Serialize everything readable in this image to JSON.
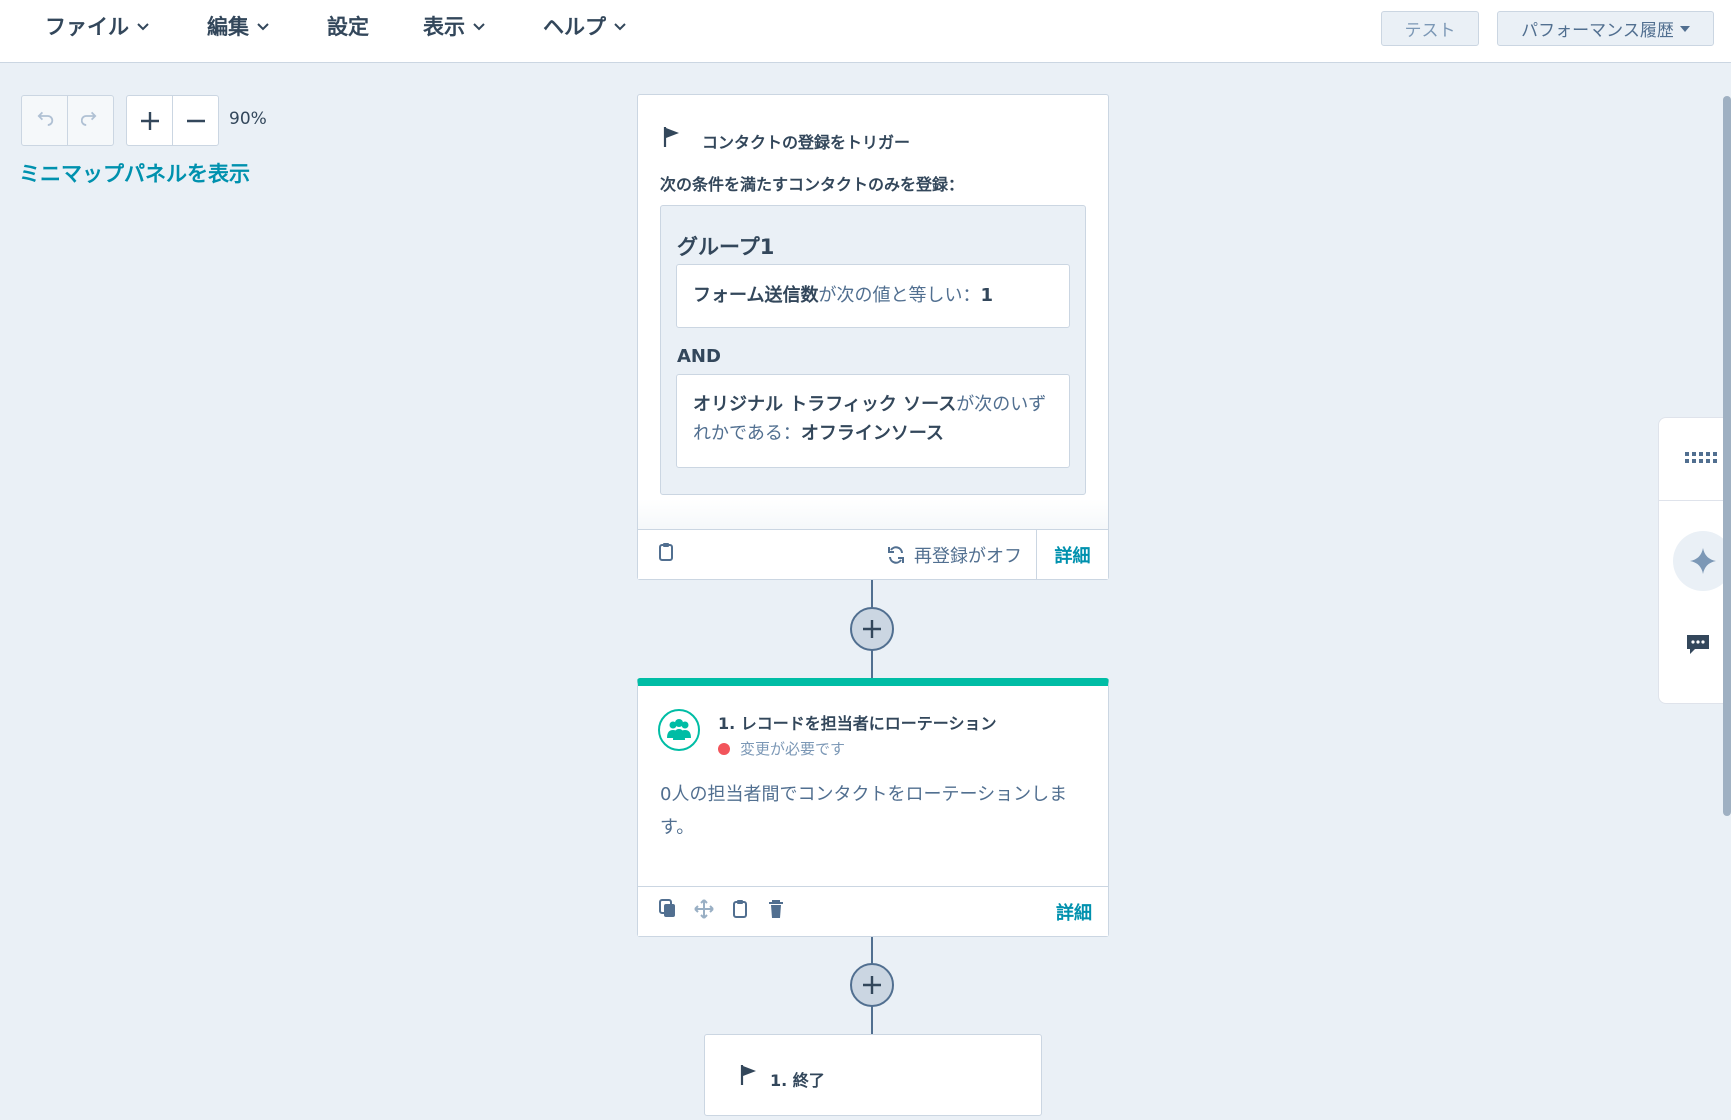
{
  "menu": {
    "file": "ファイル",
    "edit": "編集",
    "settings": "設定",
    "view": "表示",
    "help": "ヘルプ"
  },
  "header_actions": {
    "test": "テスト",
    "performance_history": "パフォーマンス履歴"
  },
  "canvas_tools": {
    "zoom_level": "90%",
    "minimap_link": "ミニマップパネルを表示"
  },
  "trigger": {
    "title": "コンタクトの登録をトリガー",
    "subtitle": "次の条件を満たすコンタクトのみを登録：",
    "group_title": "グループ1",
    "condition1": {
      "property": "フォーム送信数",
      "operator": "が次の値と等しい：",
      "value": "1"
    },
    "and_label": "AND",
    "condition2": {
      "property": "オリジナル トラフィック ソース",
      "operator": "が次のいずれかである：",
      "value": "オフラインソース"
    },
    "reenroll": "再登録がオフ",
    "details": "詳細"
  },
  "action": {
    "title": "1. レコードを担当者にローテーション",
    "status": "変更が必要です",
    "description": "0人の担当者間でコンタクトをローテーションします。",
    "details": "詳細"
  },
  "end": {
    "title": "1. 終了"
  },
  "colors": {
    "accent": "#00bda5",
    "link": "#0091ae",
    "status_error": "#f2545b",
    "canvas_bg": "#eaf0f6"
  }
}
